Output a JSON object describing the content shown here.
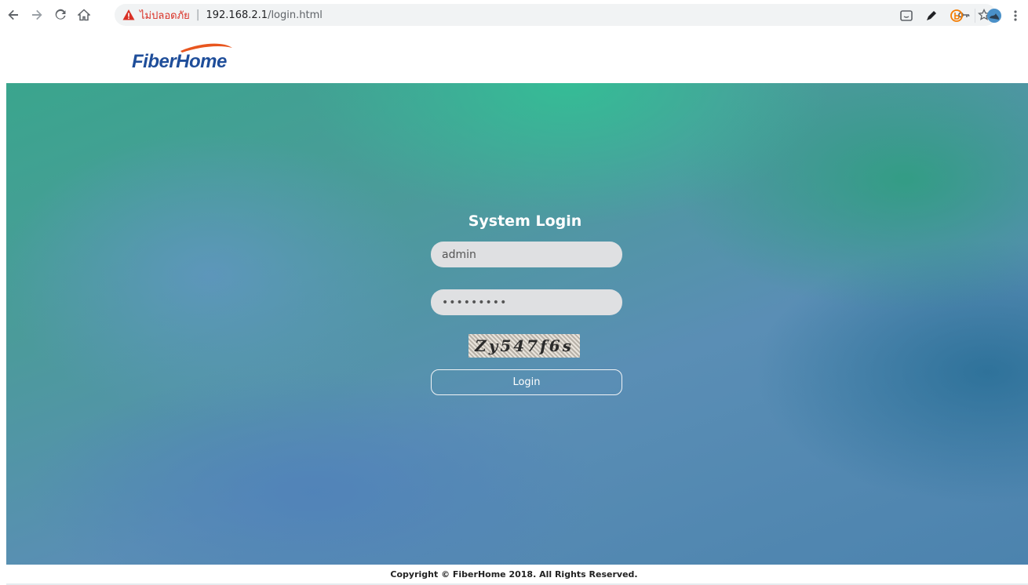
{
  "browser": {
    "warning_label": "ไม่ปลอดภัย",
    "separator": "|",
    "url_host": "192.168.2.1",
    "url_path": "/login.html"
  },
  "brand": {
    "logo_text": "FiberHome"
  },
  "login": {
    "title": "System Login",
    "username_value": "admin",
    "password_value": "•••••••••",
    "captcha_text": "Zy547f6s",
    "button_label": "Login"
  },
  "footer": {
    "copyright": "Copyright © FiberHome 2018. All Rights Reserved."
  },
  "colors": {
    "brand_blue": "#1f4e9a",
    "brand_orange": "#e8561f",
    "warning_red": "#d93025"
  }
}
